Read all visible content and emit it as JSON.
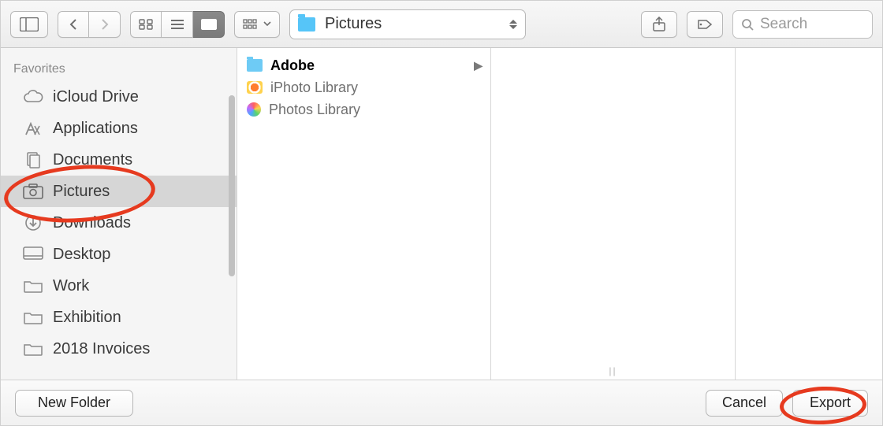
{
  "toolbar": {
    "path_label": "Pictures",
    "search_placeholder": "Search"
  },
  "sidebar": {
    "heading": "Favorites",
    "items": [
      {
        "icon": "cloud",
        "label": "iCloud Drive",
        "selected": false
      },
      {
        "icon": "apps",
        "label": "Applications",
        "selected": false
      },
      {
        "icon": "docs",
        "label": "Documents",
        "selected": false
      },
      {
        "icon": "pictures",
        "label": "Pictures",
        "selected": true
      },
      {
        "icon": "download",
        "label": "Downloads",
        "selected": false
      },
      {
        "icon": "desktop",
        "label": "Desktop",
        "selected": false
      },
      {
        "icon": "folder",
        "label": "Work",
        "selected": false
      },
      {
        "icon": "folder",
        "label": "Exhibition",
        "selected": false
      },
      {
        "icon": "folder",
        "label": "2018 Invoices",
        "selected": false
      }
    ]
  },
  "column1": {
    "items": [
      {
        "icon": "blue",
        "label": "Adobe",
        "bold": true,
        "has_children": true
      },
      {
        "icon": "iphoto",
        "label": "iPhoto Library",
        "bold": false,
        "has_children": false
      },
      {
        "icon": "photos",
        "label": "Photos Library",
        "bold": false,
        "has_children": false
      }
    ]
  },
  "footer": {
    "new_folder_label": "New Folder",
    "cancel_label": "Cancel",
    "export_label": "Export"
  }
}
